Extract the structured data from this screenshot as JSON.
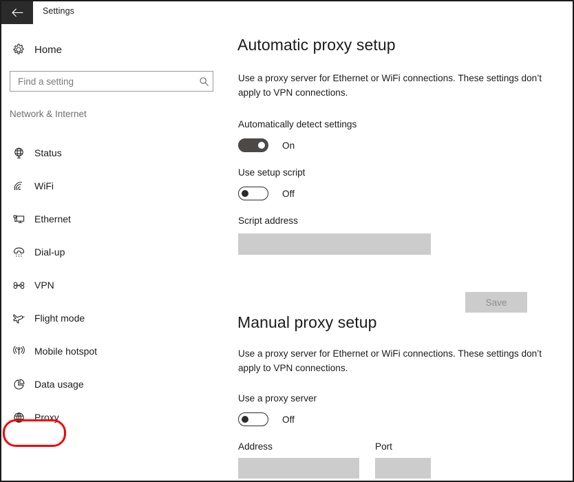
{
  "window": {
    "title": "Settings",
    "back_icon": "back-arrow-icon"
  },
  "sidebar": {
    "home": {
      "label": "Home",
      "icon": "gear-icon"
    },
    "search": {
      "value": "",
      "placeholder": "Find a setting",
      "icon": "search-icon"
    },
    "category": "Network & Internet",
    "items": [
      {
        "label": "Status",
        "icon": "globe-status-icon",
        "selected": false
      },
      {
        "label": "WiFi",
        "icon": "wifi-icon",
        "selected": false
      },
      {
        "label": "Ethernet",
        "icon": "ethernet-icon",
        "selected": false
      },
      {
        "label": "Dial-up",
        "icon": "dialup-phone-icon",
        "selected": false
      },
      {
        "label": "VPN",
        "icon": "vpn-key-icon",
        "selected": false
      },
      {
        "label": "Flight mode",
        "icon": "airplane-icon",
        "selected": false
      },
      {
        "label": "Mobile hotspot",
        "icon": "hotspot-icon",
        "selected": false
      },
      {
        "label": "Data usage",
        "icon": "pie-chart-icon",
        "selected": false
      },
      {
        "label": "Proxy",
        "icon": "globe-icon",
        "selected": true
      }
    ],
    "highlight_color": "#f60000"
  },
  "content": {
    "automatic": {
      "title": "Automatic proxy setup",
      "description": "Use a proxy server for Ethernet or WiFi connections. These settings don’t apply to VPN connections.",
      "detect_label": "Automatically detect settings",
      "detect_state": "On",
      "script_toggle_label": "Use setup script",
      "script_toggle_state": "Off",
      "script_address_label": "Script address",
      "script_address_value": "",
      "save_label": "Save"
    },
    "manual": {
      "title": "Manual proxy setup",
      "description": "Use a proxy server for Ethernet or WiFi connections. These settings don’t apply to VPN connections.",
      "proxy_toggle_label": "Use a proxy server",
      "proxy_toggle_state": "Off",
      "address_label": "Address",
      "address_value": "",
      "port_label": "Port",
      "port_value": ""
    }
  }
}
